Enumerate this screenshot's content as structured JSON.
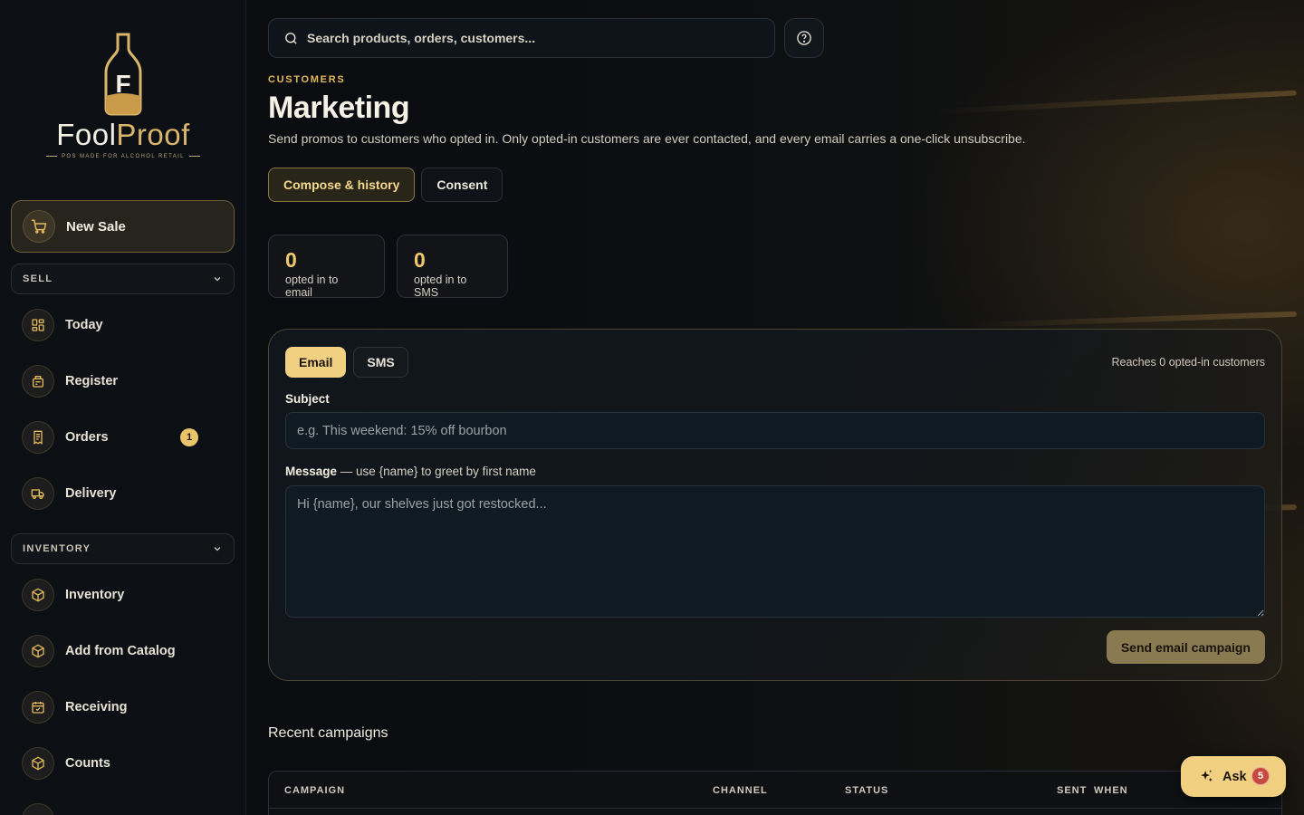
{
  "brand": {
    "name_a": "Fool",
    "name_b": "Proof",
    "tagline": "POS MADE FOR ALCOHOL RETAIL",
    "accent": "#e2b85c"
  },
  "sidebar": {
    "new_sale": {
      "label": "New Sale",
      "icon": "cart-icon"
    },
    "sections": [
      {
        "label": "SELL",
        "icon": "chevron-down-icon"
      },
      {
        "label": "INVENTORY",
        "icon": "chevron-down-icon"
      }
    ],
    "items": [
      {
        "label": "Today",
        "icon": "dashboard-icon"
      },
      {
        "label": "Register",
        "icon": "register-icon"
      },
      {
        "label": "Orders",
        "icon": "receipt-icon",
        "badge": "1"
      },
      {
        "label": "Delivery",
        "icon": "truck-icon"
      },
      {
        "label": "Inventory",
        "icon": "box-icon"
      },
      {
        "label": "Add from Catalog",
        "icon": "box-icon"
      },
      {
        "label": "Receiving",
        "icon": "calendar-check-icon"
      },
      {
        "label": "Counts",
        "icon": "box-icon"
      }
    ]
  },
  "header": {
    "search_placeholder": "Search products, orders, customers...",
    "help_icon": "help-circle-icon",
    "eyebrow": "CUSTOMERS",
    "title": "Marketing",
    "subtitle": "Send promos to customers who opted in. Only opted-in customers are ever contacted, and every email carries a one-click unsubscribe."
  },
  "tabs": [
    {
      "label": "Compose & history",
      "active": true
    },
    {
      "label": "Consent",
      "active": false
    }
  ],
  "stats": [
    {
      "value": "0",
      "label": "opted in to email"
    },
    {
      "value": "0",
      "label": "opted in to SMS"
    }
  ],
  "composer": {
    "channels": [
      {
        "label": "Email",
        "active": true
      },
      {
        "label": "SMS",
        "active": false
      }
    ],
    "reach": "Reaches 0 opted-in customers",
    "subject_label": "Subject",
    "subject_placeholder": "e.g. This weekend: 15% off bourbon",
    "subject_value": "",
    "message_label": "Message",
    "message_hint": " — use {name} to greet by first name",
    "message_placeholder": "Hi {name}, our shelves just got restocked...",
    "message_value": "",
    "send_label": "Send email campaign"
  },
  "recent": {
    "title": "Recent campaigns",
    "columns": [
      "CAMPAIGN",
      "CHANNEL",
      "STATUS",
      "SENT",
      "WHEN"
    ]
  },
  "ask": {
    "label": "Ask",
    "count": "5",
    "icon": "sparkles-icon"
  }
}
